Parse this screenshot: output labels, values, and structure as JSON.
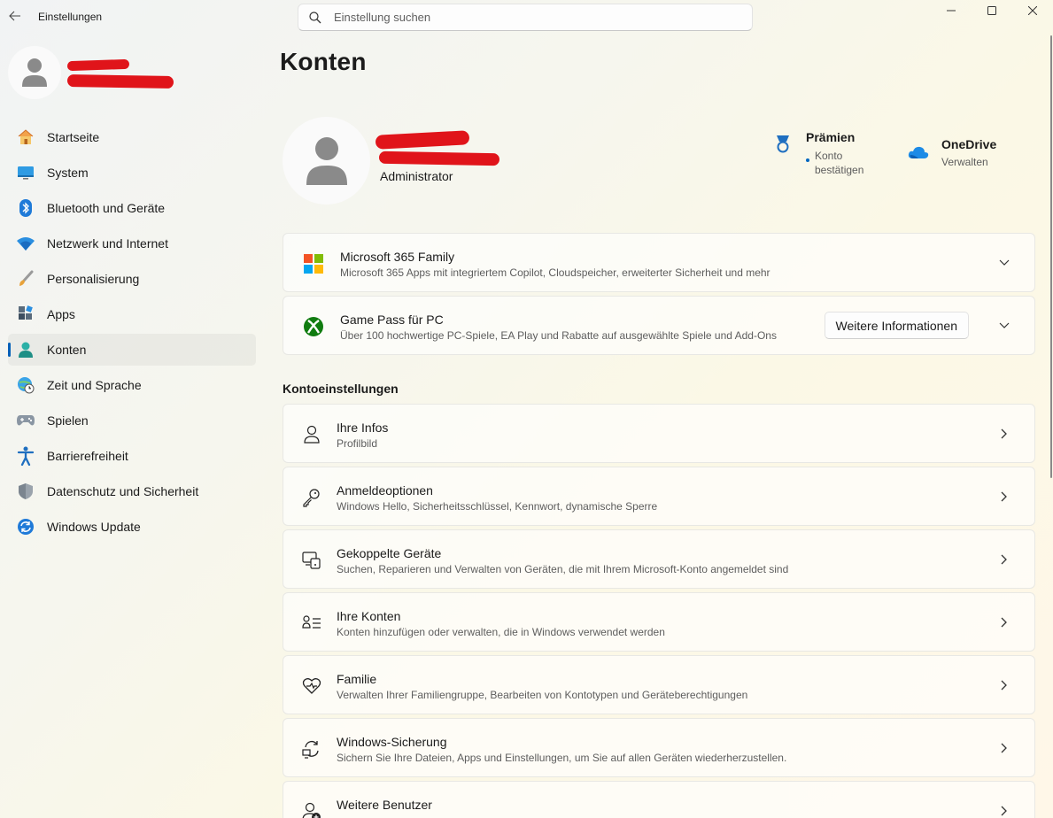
{
  "window": {
    "app_title": "Einstellungen"
  },
  "search": {
    "placeholder": "Einstellung suchen"
  },
  "sidebar": {
    "items": [
      {
        "label": "Startseite",
        "icon": "home-icon"
      },
      {
        "label": "System",
        "icon": "monitor-icon"
      },
      {
        "label": "Bluetooth und Geräte",
        "icon": "bluetooth-icon"
      },
      {
        "label": "Netzwerk und Internet",
        "icon": "wifi-icon"
      },
      {
        "label": "Personalisierung",
        "icon": "brush-icon"
      },
      {
        "label": "Apps",
        "icon": "apps-icon"
      },
      {
        "label": "Konten",
        "icon": "account-icon",
        "active": true
      },
      {
        "label": "Zeit und Sprache",
        "icon": "globe-clock-icon"
      },
      {
        "label": "Spielen",
        "icon": "gamepad-icon"
      },
      {
        "label": "Barrierefreiheit",
        "icon": "accessibility-icon"
      },
      {
        "label": "Datenschutz und Sicherheit",
        "icon": "shield-icon"
      },
      {
        "label": "Windows Update",
        "icon": "update-icon"
      }
    ]
  },
  "main": {
    "title": "Konten",
    "profile": {
      "role": "Administrator"
    },
    "rewards": {
      "title": "Prämien",
      "subtitle": "Konto bestätigen"
    },
    "onedrive": {
      "title": "OneDrive",
      "subtitle": "Verwalten"
    },
    "promos": [
      {
        "title": "Microsoft 365 Family",
        "subtitle": "Microsoft 365 Apps mit integriertem Copilot, Cloudspeicher, erweiterter Sicherheit und mehr"
      },
      {
        "title": "Game Pass für PC",
        "subtitle": "Über 100 hochwertige PC-Spiele, EA Play und Rabatte auf ausgewählte Spiele und Add-Ons",
        "button": "Weitere Informationen"
      }
    ],
    "section_title": "Kontoeinstellungen",
    "settings": [
      {
        "title": "Ihre Infos",
        "subtitle": "Profilbild",
        "icon": "person-icon"
      },
      {
        "title": "Anmeldeoptionen",
        "subtitle": "Windows Hello, Sicherheitsschlüssel, Kennwort, dynamische Sperre",
        "icon": "key-icon"
      },
      {
        "title": "Gekoppelte Geräte",
        "subtitle": "Suchen, Reparieren und Verwalten von Geräten, die mit Ihrem Microsoft-Konto angemeldet sind",
        "icon": "linked-devices-icon"
      },
      {
        "title": "Ihre Konten",
        "subtitle": "Konten hinzufügen oder verwalten, die in Windows verwendet werden",
        "icon": "accounts-list-icon"
      },
      {
        "title": "Familie",
        "subtitle": "Verwalten Ihrer Familiengruppe, Bearbeiten von Kontotypen und Geräteberechtigungen",
        "icon": "heart-icon"
      },
      {
        "title": "Windows-Sicherung",
        "subtitle": "Sichern Sie Ihre Dateien, Apps und Einstellungen, um Sie auf allen Geräten wiederherzustellen.",
        "icon": "backup-icon"
      },
      {
        "title": "Weitere Benutzer",
        "subtitle": "",
        "icon": "add-user-icon"
      }
    ]
  }
}
